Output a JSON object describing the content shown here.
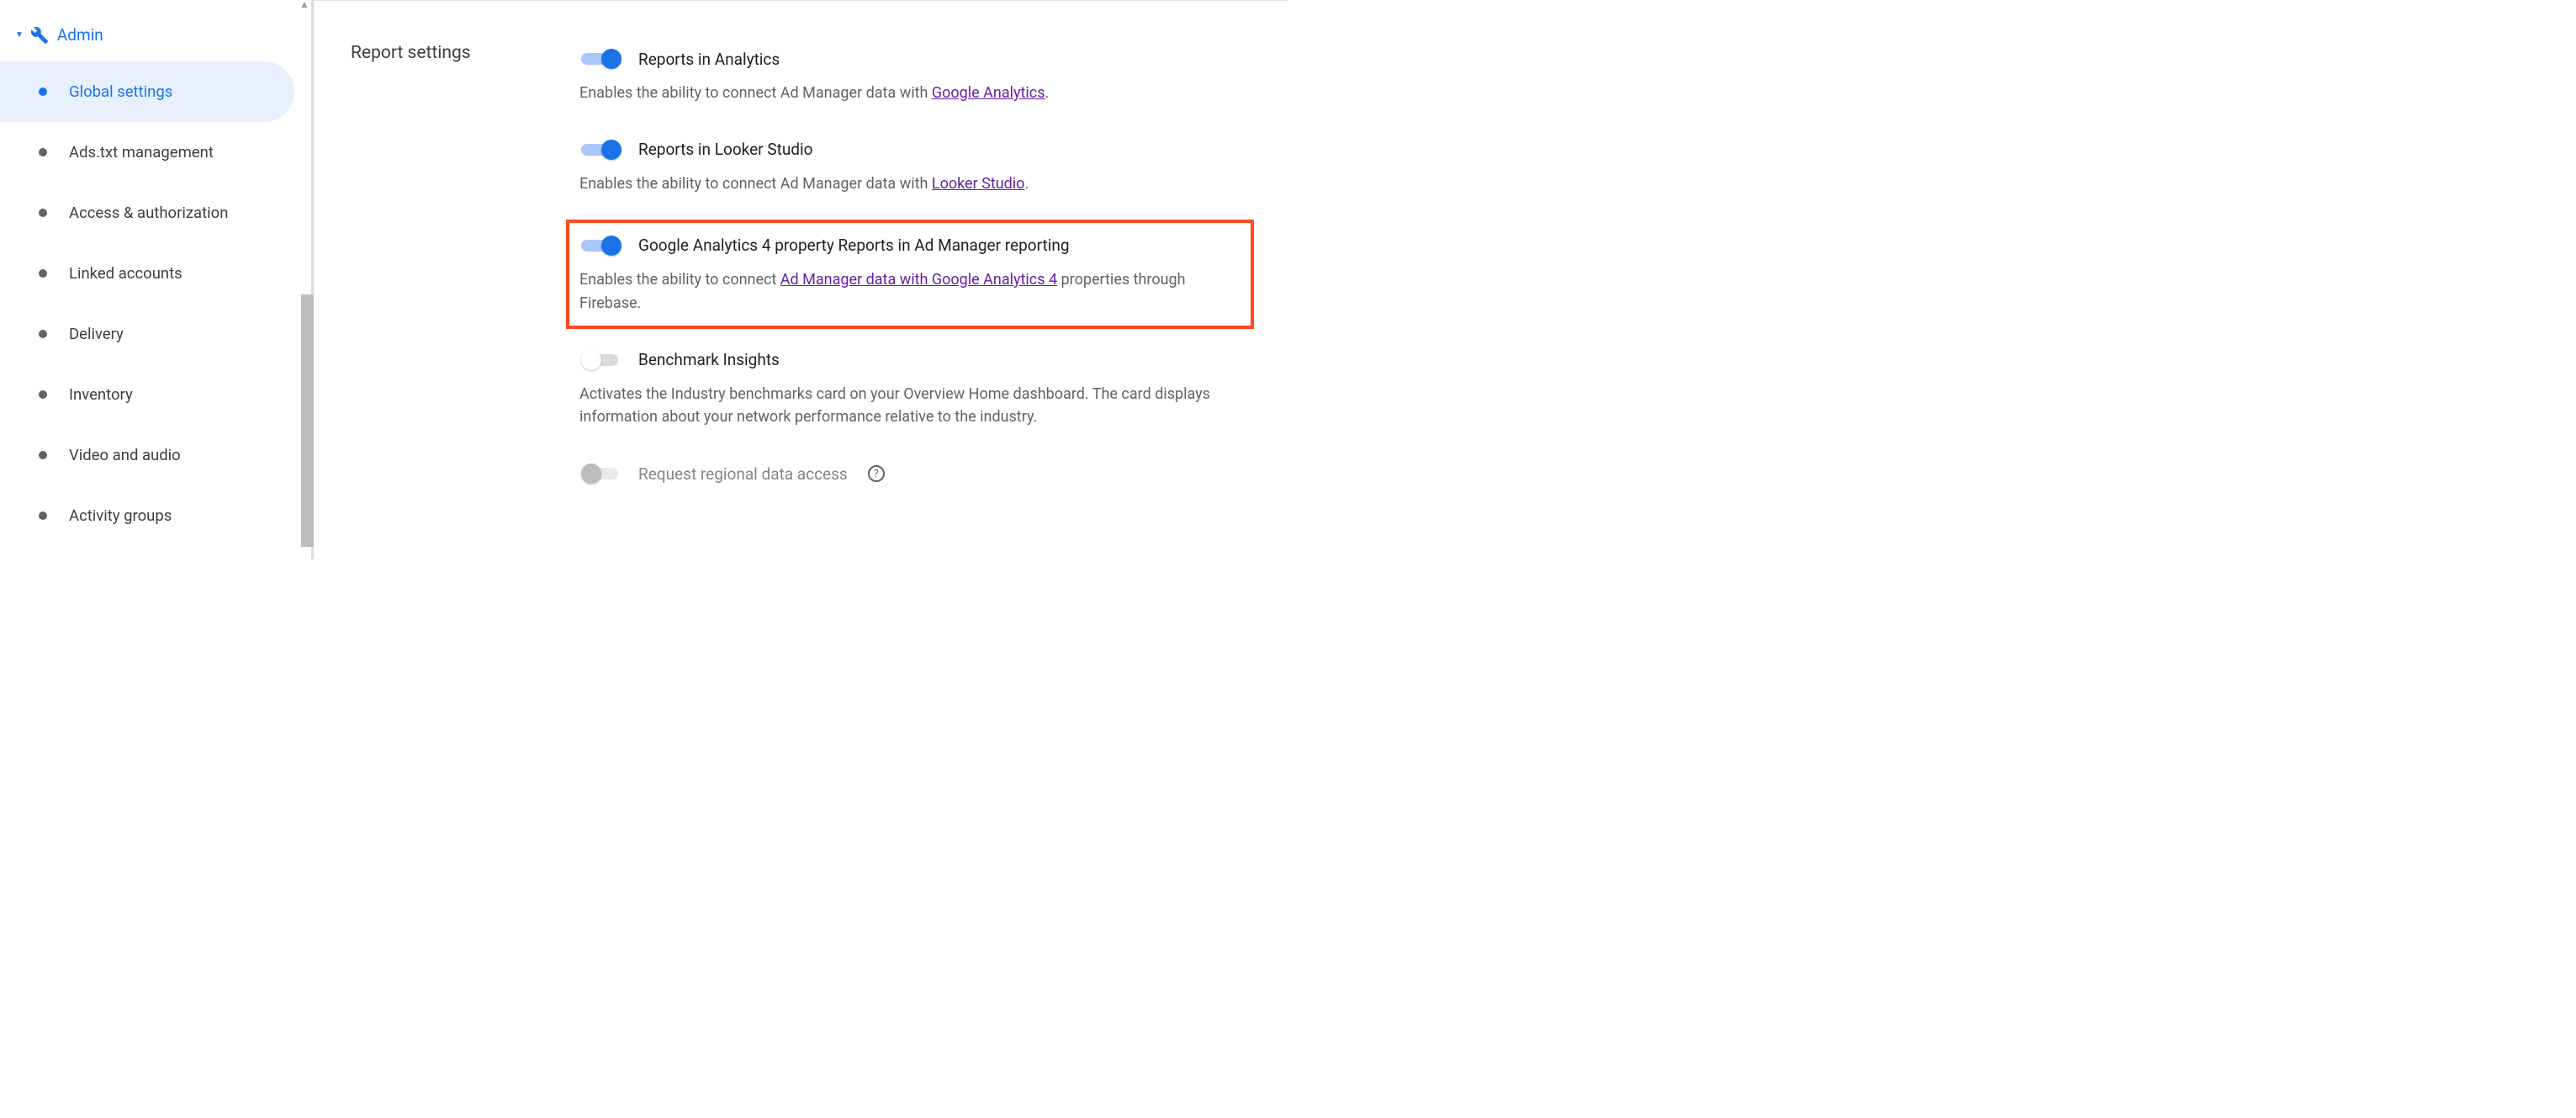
{
  "sidebar": {
    "admin_label": "Admin",
    "items": [
      {
        "label": "Global settings",
        "active": true
      },
      {
        "label": "Ads.txt management",
        "active": false
      },
      {
        "label": "Access & authorization",
        "active": false
      },
      {
        "label": "Linked accounts",
        "active": false
      },
      {
        "label": "Delivery",
        "active": false
      },
      {
        "label": "Inventory",
        "active": false
      },
      {
        "label": "Video and audio",
        "active": false
      },
      {
        "label": "Activity groups",
        "active": false
      }
    ]
  },
  "content": {
    "section_title": "Report settings",
    "settings": [
      {
        "title": "Reports in Analytics",
        "state": "on",
        "desc_pre": "Enables the ability to connect Ad Manager data with ",
        "link_text": "Google Analytics",
        "desc_post": "."
      },
      {
        "title": "Reports in Looker Studio",
        "state": "on",
        "desc_pre": "Enables the ability to connect Ad Manager data with ",
        "link_text": "Looker Studio",
        "desc_post": "."
      },
      {
        "title": "Google Analytics 4 property Reports in Ad Manager reporting",
        "state": "on",
        "desc_pre": "Enables the ability to connect ",
        "link_text": "Ad Manager data with Google Analytics 4",
        "desc_post": " properties through Firebase."
      },
      {
        "title": "Benchmark Insights",
        "state": "off",
        "desc_full": "Activates the Industry benchmarks card on your Overview Home dashboard. The card displays information about your network performance relative to the industry."
      },
      {
        "title": "Request regional data access",
        "state": "off-disabled",
        "has_help": true
      }
    ]
  }
}
